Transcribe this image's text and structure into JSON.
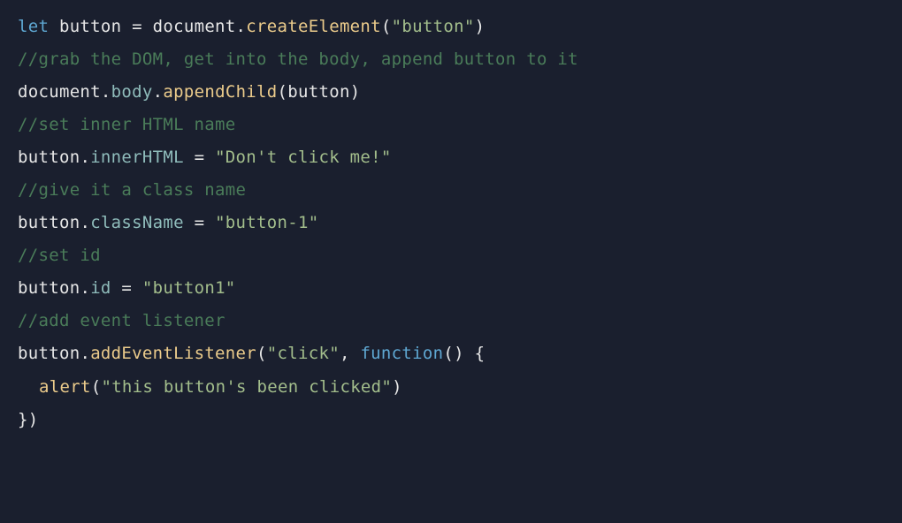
{
  "code": {
    "line1": {
      "let": "let",
      "button": " button ",
      "eq": "= ",
      "document": "document",
      "dot1": ".",
      "createElement": "createElement",
      "paren_open": "(",
      "str": "\"button\"",
      "paren_close": ")"
    },
    "line2": "//grab the DOM, get into the body, append button to it",
    "line3": {
      "document": "document",
      "dot1": ".",
      "body": "body",
      "dot2": ".",
      "appendChild": "appendChild",
      "paren_open": "(",
      "button": "button",
      "paren_close": ")"
    },
    "line4": "//set inner HTML name",
    "line5": {
      "button": "button",
      "dot": ".",
      "innerHTML": "innerHTML",
      "eq": " = ",
      "str": "\"Don't click me!\""
    },
    "line6": "//give it a class name",
    "line7": {
      "button": "button",
      "dot": ".",
      "className": "className",
      "eq": " = ",
      "str": "\"button-1\""
    },
    "line8": "//set id",
    "line9": {
      "button": "button",
      "dot": ".",
      "id": "id",
      "eq": " = ",
      "str": "\"button1\""
    },
    "line10": "//add event listener",
    "line11": {
      "button": "button",
      "dot": ".",
      "addEventListener": "addEventListener",
      "paren_open": "(",
      "str": "\"click\"",
      "comma": ", ",
      "function": "function",
      "paren2_open": "(",
      "paren2_close": ")",
      "space": " ",
      "brace_open": "{"
    },
    "line12": {
      "alert": "alert",
      "paren_open": "(",
      "str": "\"this button's been clicked\"",
      "paren_close": ")"
    },
    "line13": {
      "brace_close": "}",
      "paren_close": ")"
    }
  }
}
